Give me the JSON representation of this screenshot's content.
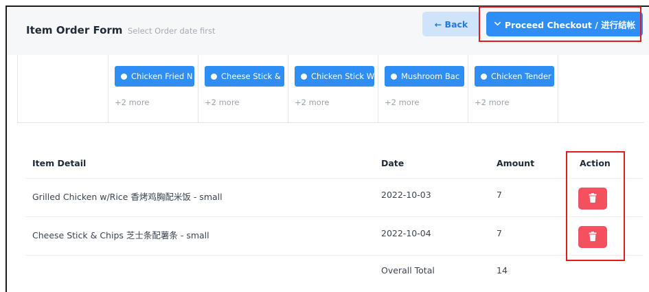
{
  "header": {
    "title": "Item Order Form",
    "subtitle": "Select Order date first",
    "back_label": "← Back",
    "checkout_label": "Proceed Checkout / 进行结帐"
  },
  "menu_grid": {
    "items": [
      {
        "chip": "Chicken Fried N",
        "more": "+2 more"
      },
      {
        "chip": "Cheese Stick &",
        "more": "+2 more"
      },
      {
        "chip": "Chicken Stick W",
        "more": "+2 more"
      },
      {
        "chip": "Mushroom Bac",
        "more": "+2 more"
      },
      {
        "chip": "Chicken Tender",
        "more": "+2 more"
      }
    ]
  },
  "table": {
    "headers": {
      "item": "Item Detail",
      "date": "Date",
      "amount": "Amount",
      "action": "Action"
    },
    "rows": [
      {
        "item": "Grilled Chicken w/Rice 香烤鸡胸配米饭 - small",
        "date": "2022-10-03",
        "amount": "7"
      },
      {
        "item": "Cheese Stick & Chips 芝士条配薯条 - small",
        "date": "2022-10-04",
        "amount": "7"
      }
    ],
    "total_label": "Overall Total",
    "total_value": "14"
  },
  "icons": {
    "back": "arrow-left-icon",
    "checkout": "chevron-down-icon",
    "delete": "trash-icon",
    "chip": "dot-icon"
  },
  "colors": {
    "primary": "#2f8ef4",
    "back_bg": "#cfe4fb",
    "danger": "#f4515e",
    "highlight": "#e01b1b"
  }
}
